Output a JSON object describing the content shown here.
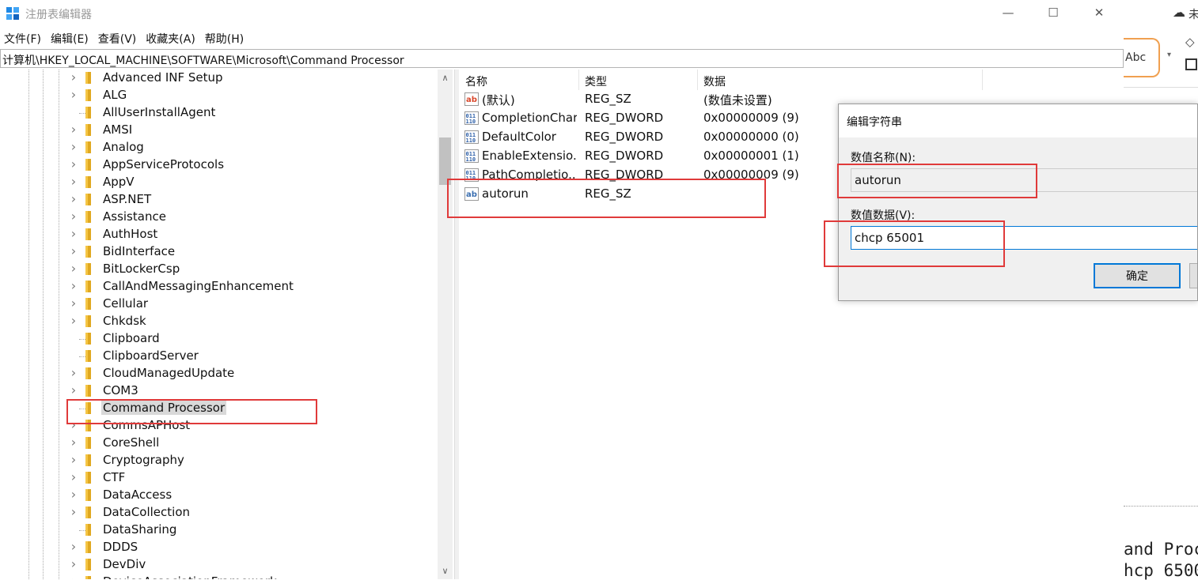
{
  "window": {
    "title": "注册表编辑器",
    "minimize_glyph": "—",
    "maximize_glyph": "☐",
    "close_glyph": "✕"
  },
  "menu": [
    "文件(F)",
    "编辑(E)",
    "查看(V)",
    "收藏夹(A)",
    "帮助(H)"
  ],
  "address": "计算机\\HKEY_LOCAL_MACHINE\\SOFTWARE\\Microsoft\\Command Processor",
  "tree_items": [
    {
      "label": "Advanced INF Setup",
      "expandable": true
    },
    {
      "label": "ALG",
      "expandable": true
    },
    {
      "label": "AllUserInstallAgent",
      "expandable": false
    },
    {
      "label": "AMSI",
      "expandable": true
    },
    {
      "label": "Analog",
      "expandable": true
    },
    {
      "label": "AppServiceProtocols",
      "expandable": true
    },
    {
      "label": "AppV",
      "expandable": true
    },
    {
      "label": "ASP.NET",
      "expandable": true
    },
    {
      "label": "Assistance",
      "expandable": true
    },
    {
      "label": "AuthHost",
      "expandable": true
    },
    {
      "label": "BidInterface",
      "expandable": true
    },
    {
      "label": "BitLockerCsp",
      "expandable": true
    },
    {
      "label": "CallAndMessagingEnhancement",
      "expandable": true
    },
    {
      "label": "Cellular",
      "expandable": true
    },
    {
      "label": "Chkdsk",
      "expandable": true
    },
    {
      "label": "Clipboard",
      "expandable": false
    },
    {
      "label": "ClipboardServer",
      "expandable": false
    },
    {
      "label": "CloudManagedUpdate",
      "expandable": true
    },
    {
      "label": "COM3",
      "expandable": true
    },
    {
      "label": "Command Processor",
      "expandable": false,
      "selected": true
    },
    {
      "label": "CommsAPHost",
      "expandable": true
    },
    {
      "label": "CoreShell",
      "expandable": true
    },
    {
      "label": "Cryptography",
      "expandable": true
    },
    {
      "label": "CTF",
      "expandable": true
    },
    {
      "label": "DataAccess",
      "expandable": true
    },
    {
      "label": "DataCollection",
      "expandable": true
    },
    {
      "label": "DataSharing",
      "expandable": false
    },
    {
      "label": "DDDS",
      "expandable": true
    },
    {
      "label": "DevDiv",
      "expandable": true
    },
    {
      "label": "DeviceAssociationFramework",
      "expandable": true
    }
  ],
  "scroll": {
    "up": "∧",
    "down": "∨"
  },
  "list_headers": [
    "名称",
    "类型",
    "数据"
  ],
  "values": [
    {
      "name": "(默认)",
      "type": "REG_SZ",
      "data": "(数值未设置)",
      "icon": "string-icon"
    },
    {
      "name": "CompletionChar",
      "type": "REG_DWORD",
      "data": "0x00000009 (9)",
      "icon": "binary-icon"
    },
    {
      "name": "DefaultColor",
      "type": "REG_DWORD",
      "data": "0x00000000 (0)",
      "icon": "binary-icon"
    },
    {
      "name": "EnableExtensio...",
      "type": "REG_DWORD",
      "data": "0x00000001 (1)",
      "icon": "binary-icon"
    },
    {
      "name": "PathCompletio...",
      "type": "REG_DWORD",
      "data": "0x00000009 (9)",
      "icon": "binary-icon"
    },
    {
      "name": "autorun",
      "type": "REG_SZ",
      "data": "",
      "icon": "string-icon"
    }
  ],
  "dialog": {
    "title": "编辑字符串",
    "name_label": "数值名称(N):",
    "name_value": "autorun",
    "data_label": "数值数据(V):",
    "data_value": "chcp 65001",
    "ok_label": "确定",
    "cancel_label": ""
  },
  "background": {
    "abc_label": "Abc",
    "top_text": "未",
    "code_lines": [
      "and Proc",
      "hcp 6500"
    ]
  },
  "colors": {
    "highlight": "#e03a3a",
    "folder": "#f5c646",
    "accent": "#0078d7"
  }
}
